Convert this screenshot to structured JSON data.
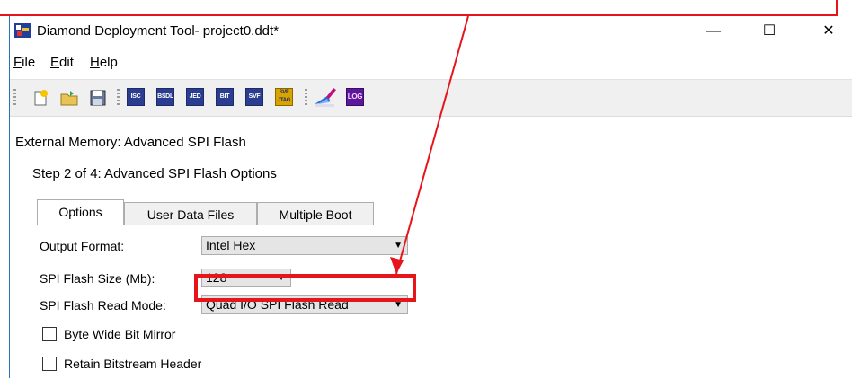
{
  "window": {
    "title": "Diamond Deployment Tool- project0.ddt*",
    "controls": {
      "minimize": "—",
      "maximize": "☐",
      "close": "✕"
    }
  },
  "menu": [
    {
      "label": "File",
      "mnemonic": "F",
      "rest": "ile"
    },
    {
      "label": "Edit",
      "mnemonic": "E",
      "rest": "dit"
    },
    {
      "label": "Help",
      "mnemonic": "H",
      "rest": "elp"
    }
  ],
  "toolbar": {
    "buttons": [
      "new-file-icon",
      "open-folder-icon",
      "save-icon",
      "ISC",
      "BSDL",
      "JED",
      "BIT",
      "SVF",
      "SVF JTAG",
      "edit-wand-icon",
      "LOG"
    ]
  },
  "page": {
    "heading": "External Memory:  Advanced SPI Flash",
    "step": "Step 2 of 4: Advanced SPI Flash Options"
  },
  "tabs": [
    {
      "label": "Options",
      "active": true
    },
    {
      "label": "User Data Files",
      "active": false
    },
    {
      "label": "Multiple Boot",
      "active": false
    }
  ],
  "form": {
    "output_format": {
      "label": "Output Format:",
      "value": "Intel Hex"
    },
    "flash_size": {
      "label": "SPI Flash Size (Mb):",
      "value": "128"
    },
    "read_mode": {
      "label": "SPI Flash Read Mode:",
      "value": "Quad I/O SPI Flash Read"
    },
    "byte_wide": {
      "label": "Byte Wide Bit Mirror",
      "checked": false
    },
    "retain_header": {
      "label": "Retain Bitstream Header",
      "checked": false
    }
  },
  "annotation": {
    "color": "#e8141b"
  }
}
